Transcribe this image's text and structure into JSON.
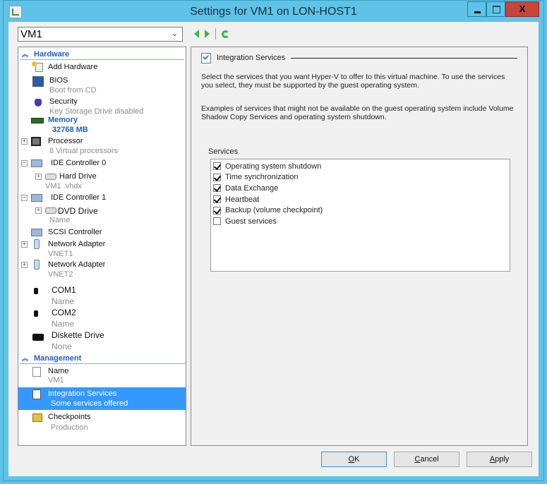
{
  "window": {
    "title": "Settings for VM1 on LON-HOST1",
    "close_glyph": "X"
  },
  "toolbar": {
    "vm_selected": "VM1",
    "dropdown_glyph": "⌄"
  },
  "tree": {
    "hardware_label": "Hardware",
    "management_label": "Management",
    "items": [
      {
        "label": "Add Hardware",
        "sub": ""
      },
      {
        "label": "BIOS",
        "sub": "Boot from CD"
      },
      {
        "label": "Security",
        "sub": "Key Storage Drive disabled"
      },
      {
        "label": "Memory",
        "sub": "32768 MB"
      },
      {
        "label": "Processor",
        "sub": "8 Virtual processors"
      },
      {
        "label": "IDE Controller  0",
        "sub": ""
      },
      {
        "label": "Hard Drive",
        "sub": "VM1 .vhdx"
      },
      {
        "label": "IDE Controller  1",
        "sub": ""
      },
      {
        "label": "DVD Drive",
        "sub": "Name"
      },
      {
        "label": "SCSI Controller",
        "sub": ""
      },
      {
        "label": "Network Adapter",
        "sub": "VNET1"
      },
      {
        "label": "Network Adapter",
        "sub": "VNET2"
      },
      {
        "label": "COM1",
        "sub": "Name"
      },
      {
        "label": "COM2",
        "sub": "Name"
      },
      {
        "label": "Diskette Drive",
        "sub": "None"
      },
      {
        "label": "Name",
        "sub": "VM1"
      },
      {
        "label": "Integration Services",
        "sub": "Some services offered"
      },
      {
        "label": "Checkpoints",
        "sub": "Production"
      }
    ]
  },
  "panel": {
    "title": "Integration Services",
    "description": "Select the services that you want Hyper-V to offer to this virtual machine. To use the services you select, they must be supported by the guest operating system.",
    "examples": "Examples of services that might not be available on the guest operating system include Volume Shadow Copy Services and operating system shutdown.",
    "services_label": "Services",
    "services": [
      {
        "name": "Operating system shutdown",
        "checked": true
      },
      {
        "name": "Time synchronization",
        "checked": true
      },
      {
        "name": "Data Exchange",
        "checked": true
      },
      {
        "name": "Heartbeat",
        "checked": true
      },
      {
        "name": "Backup (volume checkpoint)",
        "checked": true
      },
      {
        "name": "Guest services",
        "checked": false
      }
    ]
  },
  "buttons": {
    "ok_accel": "O",
    "ok_rest": "K",
    "cancel_accel": "C",
    "cancel_rest": "ancel",
    "apply_accel": "A",
    "apply_rest": "pply"
  },
  "colors": {
    "frame": "#5ec3e6",
    "close": "#c7453a",
    "selection": "#3399ff",
    "category": "#1f5fbf",
    "nav_green": "#3db54a"
  }
}
